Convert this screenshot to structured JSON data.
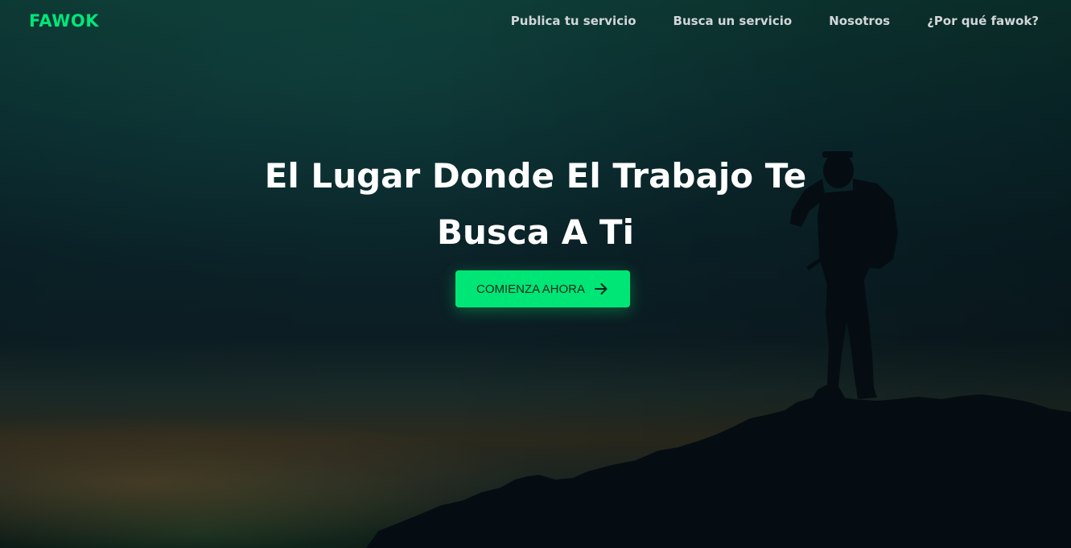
{
  "colors": {
    "brand": "#02e579",
    "button_bg": "#00e676",
    "nav_text": "#d2d6d8",
    "headline": "#ffffff"
  },
  "nav": {
    "brand": "FAWOK",
    "links": [
      {
        "label": "Publica tu servicio"
      },
      {
        "label": "Busca un servicio"
      },
      {
        "label": "Nosotros"
      },
      {
        "label": "¿Por qué fawok?"
      }
    ]
  },
  "hero": {
    "headline": "El Lugar Donde El Trabajo Te Busca A Ti",
    "cta_label": "COMIENZA AHORA",
    "cta_icon": "arrow-right-icon",
    "background_image": "hiker-silhouette-on-mountain-at-dusk"
  }
}
